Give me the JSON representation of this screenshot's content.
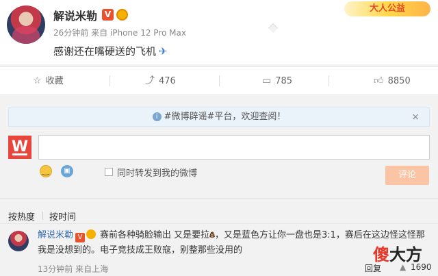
{
  "post": {
    "author": "解说米勒",
    "v_badge": "V",
    "meta": "26分钟前 来自 iPhone 12 Pro Max",
    "content": "感谢还在嘴硬送的飞机",
    "content_icon": "airplane-icon",
    "banner": "大人公益"
  },
  "actions": {
    "favorite": {
      "icon": "star-icon",
      "label": "收藏"
    },
    "repost": {
      "icon": "repost-icon",
      "count": "476"
    },
    "comment": {
      "icon": "comment-icon",
      "count": "785"
    },
    "like": {
      "icon": "thumbs-up-icon",
      "count": "8850"
    }
  },
  "comment_panel": {
    "notice": "#微博辟谣#平台，欢迎查阅！",
    "input_value": "",
    "repost_checkbox_label": "同时转发到我的微博",
    "submit_label": "评论",
    "colors": {
      "accent": "#e8453c",
      "submit_disabled": "#fbc4a5",
      "link": "#3a6fb5"
    }
  },
  "sort": {
    "hot": "按热度",
    "time": "按时间"
  },
  "comments": [
    {
      "author": "解说米勒",
      "v_badge": "V",
      "text_before": "赛前各种骑脸输出 又是要拉",
      "text_after": "，又是蓝色方让你一盘也是3:1，赛后在这边怪这怪那我是没想到的。电子竞技成王败寇，别整那些没用的",
      "meta": "13分钟前 来自上海",
      "reply": "回复",
      "likes": "1690"
    }
  ],
  "watermark": {
    "part1": "傻",
    "part2": "大方"
  }
}
